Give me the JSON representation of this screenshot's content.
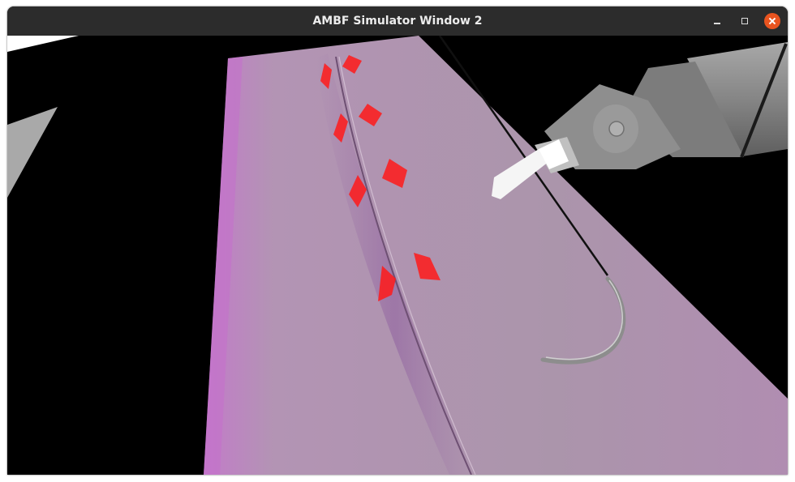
{
  "window": {
    "title": "AMBF Simulator Window 2",
    "buttons": {
      "minimize_icon": "minimize-icon",
      "maximize_icon": "maximize-icon",
      "close_icon": "close-icon"
    },
    "colors": {
      "titlebar": "#2c2c2c",
      "close_button": "#e9541f"
    }
  },
  "scene": {
    "background_color": "#000000",
    "tissue_color": "#b38fb5",
    "tissue_edge_color": "#c070c8",
    "marker_color": "#ff2020",
    "robot_color": "#8a8a8a",
    "needle_color": "#9a9a9a",
    "marker_count": 8,
    "objects": [
      "tissue-phantom",
      "incision-line",
      "suture-markers",
      "robot-tool",
      "suture-needle",
      "suture-thread"
    ]
  }
}
